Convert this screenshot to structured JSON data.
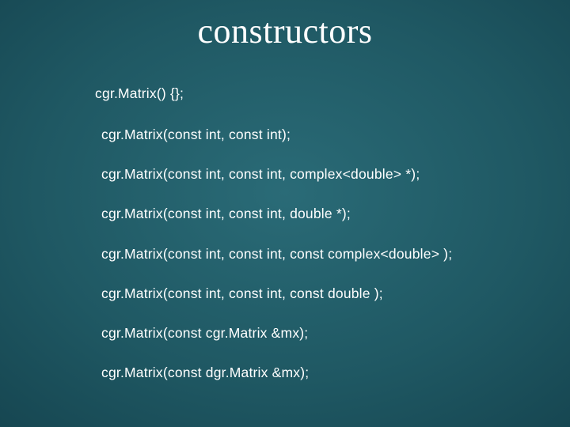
{
  "title": "constructors",
  "lines": [
    "cgr.Matrix() {};",
    "cgr.Matrix(const int, const int);",
    "cgr.Matrix(const int, const int, complex<double> *);",
    "cgr.Matrix(const int, const int, double *);",
    "cgr.Matrix(const int, const int, const complex<double> );",
    "cgr.Matrix(const int, const int, const double );",
    "cgr.Matrix(const cgr.Matrix &mx);",
    "cgr.Matrix(const dgr.Matrix &mx);"
  ]
}
